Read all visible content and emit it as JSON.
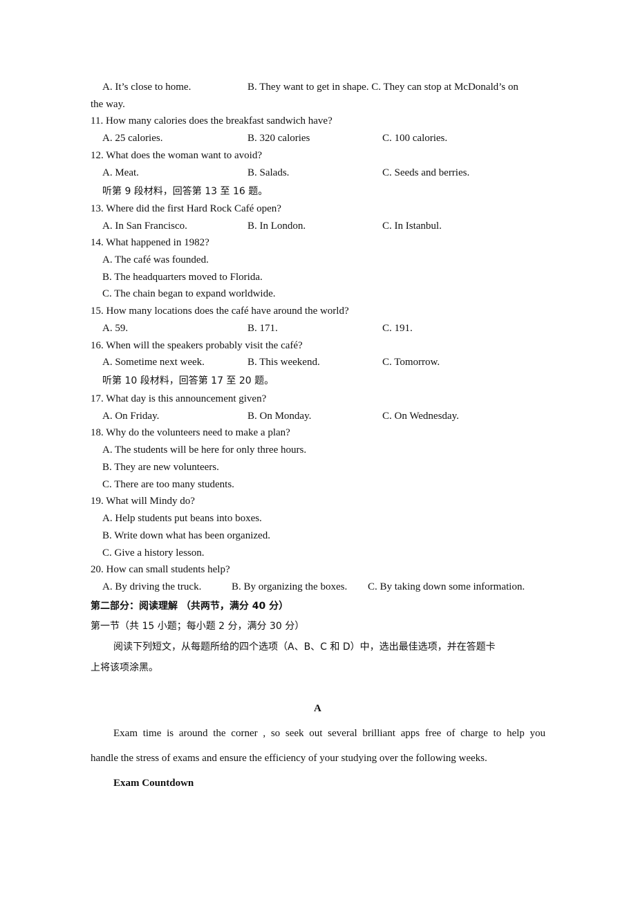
{
  "lines": [
    {
      "t": "A. It’s close to home."
    },
    {
      "t": "B. They want to get in shape. C. They can stop at McDonald’s on"
    },
    {
      "t": "the way."
    },
    {
      "t": "11. How many calories does the breakfast sandwich have?"
    },
    {
      "a": "A. 25 calories.",
      "b": "B. 320 calories",
      "c": "C. 100 calories."
    },
    {
      "t": "12. What does the woman want to avoid?"
    },
    {
      "a": "A. Meat.",
      "b": "B. Salads.",
      "c": "C. Seeds and berries."
    },
    {
      "t": "听第 9 段材料，回答第 13 至 16 题。"
    },
    {
      "t": "13. Where did the first Hard Rock Café open?"
    },
    {
      "a": "A. In San Francisco.",
      "b": "B. In London.",
      "c": "C. In Istanbul."
    },
    {
      "t": "14. What happened in 1982?"
    },
    {
      "t": "A. The café was founded."
    },
    {
      "t": "B. The headquarters moved to Florida."
    },
    {
      "t": "C. The chain began to expand worldwide."
    },
    {
      "t": "15. How many locations does the café have around the world?"
    },
    {
      "a": "A. 59.",
      "b": "B. 171.",
      "c": "C. 191."
    },
    {
      "t": "16. When will the speakers probably visit the café?"
    },
    {
      "a": "A. Sometime next week.",
      "b": "B. This weekend.",
      "c": "C. Tomorrow."
    },
    {
      "t": "听第 10 段材料，回答第 17 至 20 题。"
    },
    {
      "t": "17. What day is this announcement given?"
    },
    {
      "a": "A. On Friday.",
      "b": "B. On Monday.",
      "c": "C. On Wednesday."
    },
    {
      "t": "18. Why do the volunteers need to make a plan?"
    },
    {
      "t": "A. The students will be here for only three hours."
    },
    {
      "t": "B. They are new volunteers."
    },
    {
      "t": "C. There are too many students."
    },
    {
      "t": "19. What will Mindy do?"
    },
    {
      "t": "A. Help students put beans into boxes."
    },
    {
      "t": "B. Write down what has been organized."
    },
    {
      "t": "C. Give a history lesson."
    },
    {
      "t": "20. How can small students help?"
    },
    {
      "a": "A. By driving the truck.",
      "b": "B. By organizing the boxes.",
      "c": "C. By taking down some information."
    }
  ],
  "section": {
    "part2_title": "第二部分：阅读理解 （共两节，满分 40 分）",
    "sec1_title": "第一节（共 15 小题；每小题 2 分，满分 30 分）",
    "instr1": "阅读下列短文，从每题所给的四个选项（A、B、C 和 D）中，选出最佳选项，并在答题卡",
    "instr2": "上将该项涂黑。",
    "passage_label": "A",
    "p1": "Exam time is around the corner , so seek out several brilliant apps free of charge to help you",
    "p2": "handle the stress of exams and ensure the efficiency of your studying over the following weeks.",
    "heading": "Exam Countdown"
  }
}
